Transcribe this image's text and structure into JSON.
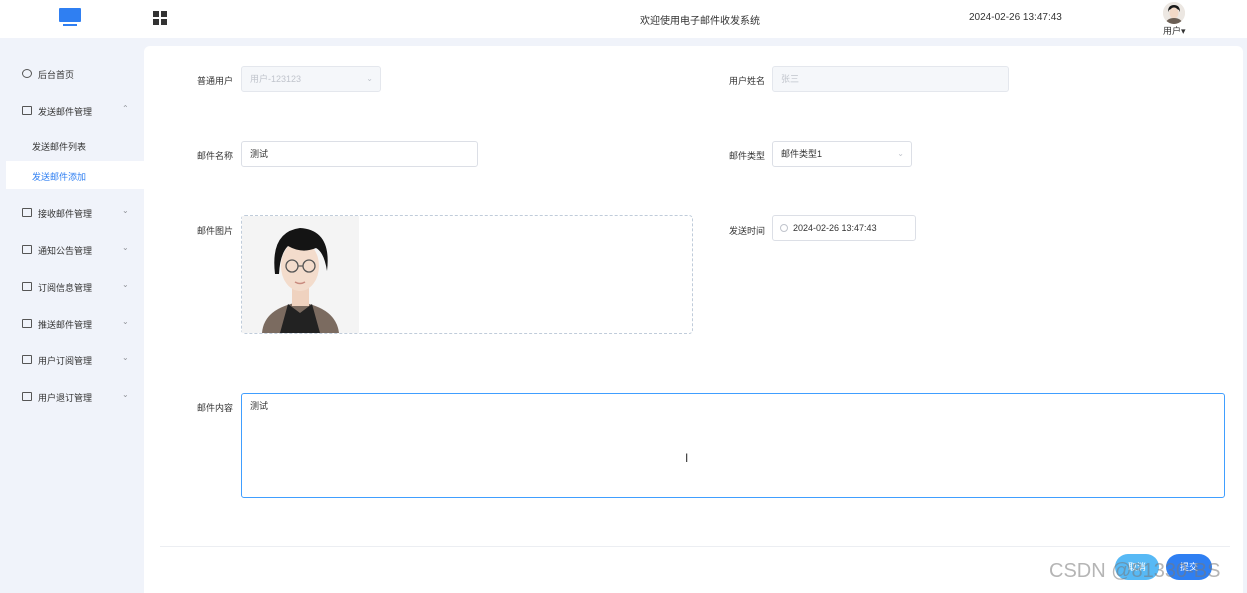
{
  "header": {
    "site_title": "欢迎使用电子邮件收发系统",
    "datetime": "2024-02-26 13:47:43",
    "user_menu": "用户",
    "user_menu_caret": "▾"
  },
  "sidebar": {
    "items": [
      {
        "label": "后台首页",
        "icon": "clock-icon",
        "arrow": ""
      },
      {
        "label": "发送邮件管理",
        "icon": "menu-box-icon",
        "arrow": "⌃"
      },
      {
        "label": "接收邮件管理",
        "icon": "menu-box-icon",
        "arrow": "⌄"
      },
      {
        "label": "通知公告管理",
        "icon": "menu-box-icon",
        "arrow": "⌄"
      },
      {
        "label": "订阅信息管理",
        "icon": "menu-box-icon",
        "arrow": "⌄"
      },
      {
        "label": "推送邮件管理",
        "icon": "menu-box-icon",
        "arrow": "⌄"
      },
      {
        "label": "用户订阅管理",
        "icon": "menu-box-icon",
        "arrow": "⌄"
      },
      {
        "label": "用户退订管理",
        "icon": "menu-box-icon",
        "arrow": "⌄"
      }
    ],
    "subitems": [
      {
        "label": "发送邮件列表"
      },
      {
        "label": "发送邮件添加"
      }
    ]
  },
  "form": {
    "user_label": "普通用户",
    "user_value": "用户-123123",
    "user_chevron": "⌄",
    "name_label": "用户姓名",
    "name_value": "张三",
    "mail_name_label": "邮件名称",
    "mail_name_value": "测试",
    "mail_type_label": "邮件类型",
    "mail_type_value": "邮件类型1",
    "mail_type_chevron": "⌄",
    "image_label": "邮件图片",
    "send_time_label": "发送时间",
    "send_time_value": "2024-02-26 13:47:43",
    "content_label": "邮件内容",
    "content_value": "测试",
    "text_cursor": "I"
  },
  "buttons": {
    "cancel_label": "取消",
    "submit_label": "提交"
  },
  "watermark": "CSDN @81330-BS",
  "colors": {
    "accent": "#2f7ff2",
    "cancel": "#57b9f5",
    "focus_border": "#409eff"
  }
}
